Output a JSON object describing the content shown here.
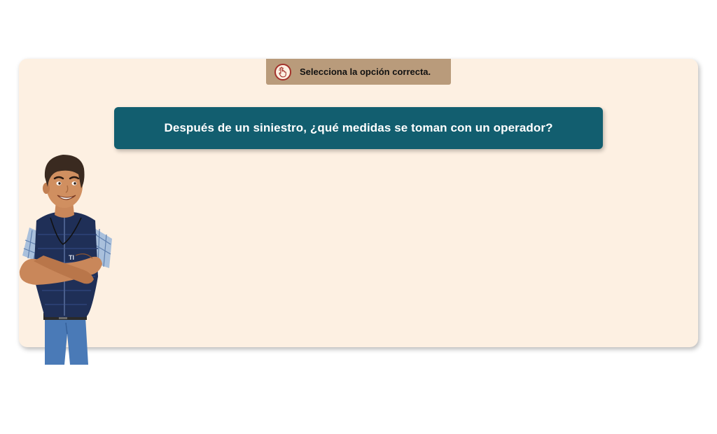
{
  "instruction": {
    "icon": "touch-hand-icon",
    "text": "Selecciona la opción correcta."
  },
  "question": {
    "text": "Después de un siniestro, ¿qué medidas se toman con un operador?"
  },
  "character": {
    "vest_text": "TI"
  },
  "colors": {
    "panel_background": "#fdf0e2",
    "instruction_tab": "#b99b7b",
    "question_box": "#125e6f",
    "icon_accent": "#a3322b"
  }
}
